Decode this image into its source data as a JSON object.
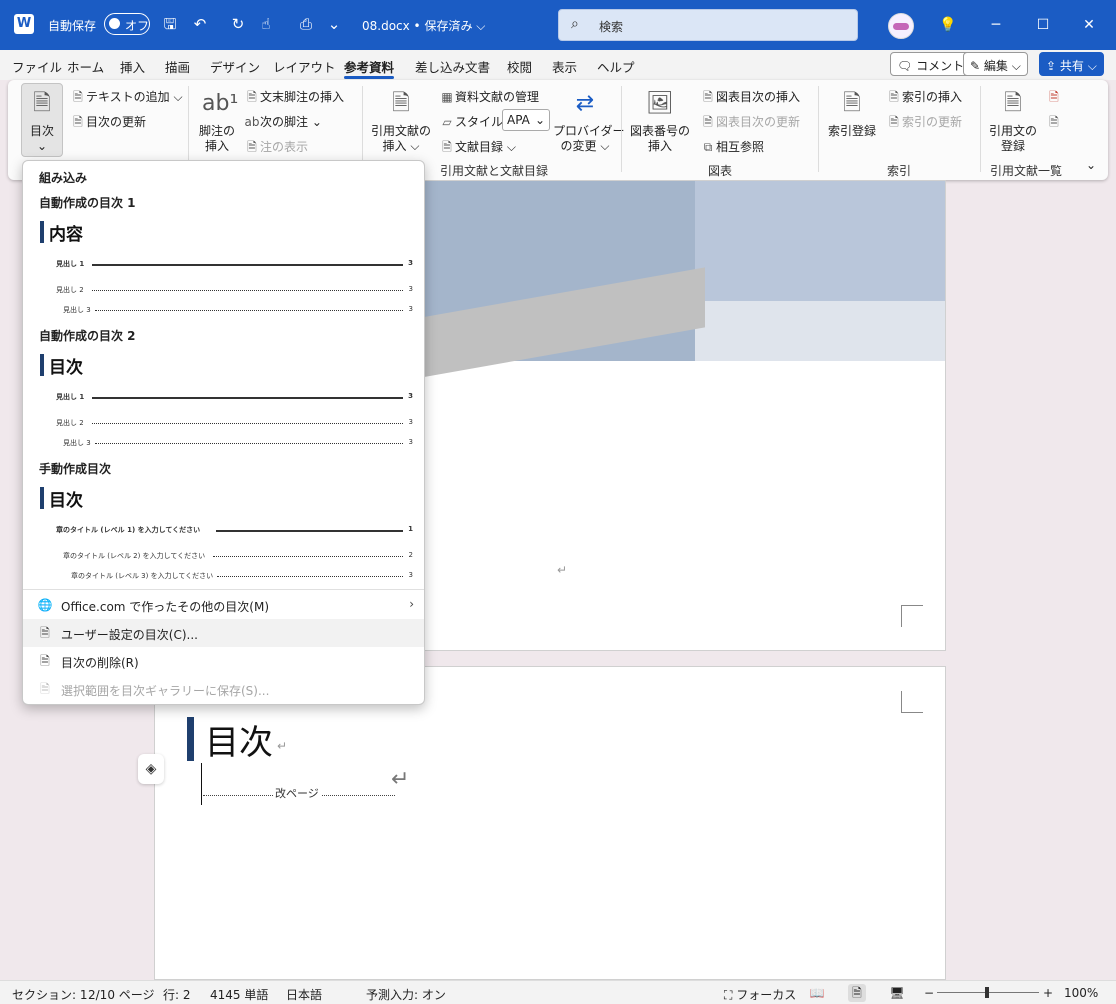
{
  "titlebar": {
    "app_logo": "W",
    "autosave_label": "自動保存",
    "autosave_state": "オフ",
    "doc_title": "08.docx • 保存済み ⌵",
    "search_placeholder": "検索"
  },
  "tabs": [
    "ファイル",
    "ホーム",
    "挿入",
    "描画",
    "デザイン",
    "レイアウト",
    "参考資料",
    "差し込み文書",
    "校閲",
    "表示",
    "ヘルプ"
  ],
  "active_tab": "参考資料",
  "right_buttons": {
    "comment": "コメント",
    "edit": "編集 ⌵",
    "share": "共有 ⌵"
  },
  "ribbon": {
    "toc": {
      "label": "目次",
      "add_text": "テキストの追加 ⌵",
      "update": "目次の更新"
    },
    "footnotes": {
      "insert": "脚注の\n挿入",
      "endnote": "文末脚注の挿入",
      "next": "次の脚注",
      "show": "注の表示"
    },
    "citations": {
      "insert": "引用文献の\n挿入 ⌵",
      "manage": "資料文献の管理",
      "style_label": "スタイル:",
      "style_value": "APA",
      "bibliography": "文献目録 ⌵",
      "provider": "プロバイダー\nの変更 ⌵",
      "group": "引用文献と文献目録"
    },
    "captions": {
      "insert": "図表番号の\n挿入",
      "insert_tof": "図表目次の挿入",
      "update_tof": "図表目次の更新",
      "cross_ref": "相互参照",
      "group": "図表"
    },
    "index": {
      "mark": "索引登録",
      "insert": "索引の挿入",
      "update": "索引の更新",
      "group": "索引"
    },
    "authorities": {
      "mark": "引用文の\n登録",
      "group": "引用文献一覧"
    }
  },
  "gallery": {
    "section_builtin": "組み込み",
    "auto1": {
      "name": "自動作成の目次 1",
      "title": "内容"
    },
    "auto2": {
      "name": "自動作成の目次 2",
      "title": "目次"
    },
    "manual": {
      "name": "手動作成目次",
      "title": "目次"
    },
    "heading1": "見出し 1",
    "heading2": "見出し 2",
    "heading3": "見出し 3",
    "page_num": "3",
    "manual_l1": "章のタイトル (レベル 1) を入力してください",
    "manual_l2": "章のタイトル (レベル 2) を入力してください",
    "manual_l3": "章のタイトル (レベル 3) を入力してください",
    "manual_n1": "1",
    "manual_n2": "2",
    "manual_n3": "3",
    "menu": [
      {
        "label": "Office.com で作ったその他の目次(M)",
        "icon": "globe-icon"
      },
      {
        "label": "ユーザー設定の目次(C)...",
        "icon": "doc-icon"
      },
      {
        "label": "目次の削除(R)",
        "icon": "doc-remove-icon"
      },
      {
        "label": "選択範囲を目次ギャラリーに保存(S)...",
        "icon": "doc-save-icon"
      }
    ]
  },
  "document": {
    "toc_heading": "目次",
    "page_break": "改ページ"
  },
  "statusbar": {
    "section": "セクション: 1",
    "page": "2/10 ページ",
    "line": "行: 2",
    "words": "4145 単語",
    "language": "日本語",
    "predict": "予測入力: オン",
    "focus": "フォーカス",
    "zoom_minus": "−",
    "zoom_plus": "+",
    "zoom": "100%"
  }
}
